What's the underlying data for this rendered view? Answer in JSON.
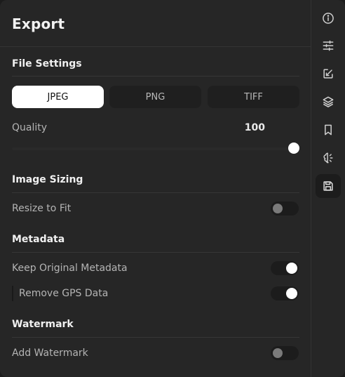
{
  "panel": {
    "title": "Export"
  },
  "file_settings": {
    "title": "File Settings",
    "formats": [
      "JPEG",
      "PNG",
      "TIFF"
    ],
    "selected_format": "JPEG",
    "quality_label": "Quality",
    "quality_value": "100",
    "quality_fraction": 1.0
  },
  "image_sizing": {
    "title": "Image Sizing",
    "resize_label": "Resize to Fit",
    "resize_on": false
  },
  "metadata": {
    "title": "Metadata",
    "keep_label": "Keep Original Metadata",
    "keep_on": true,
    "gps_label": "Remove GPS Data",
    "gps_on": true
  },
  "watermark": {
    "title": "Watermark",
    "add_label": "Add Watermark",
    "add_on": false
  },
  "sidebar": {
    "icons": [
      "info-icon",
      "adjustments-icon",
      "export-icon",
      "layers-icon",
      "bookmark-icon",
      "ai-brain-icon",
      "save-icon"
    ],
    "active_icon": "save-icon"
  },
  "colors": {
    "background": "#262626",
    "active_segment": "#ffffff",
    "toggle_on_knob": "#ffffff",
    "toggle_off_knob": "#7a7a7a"
  }
}
